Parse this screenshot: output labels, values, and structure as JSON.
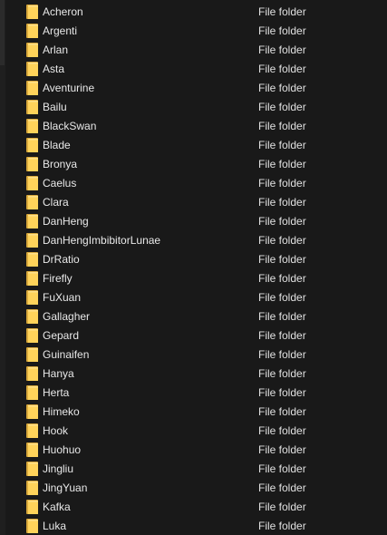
{
  "folder_icon": "folder-icon",
  "colors": {
    "background": "#191919",
    "folder_yellow": "#ffd35a",
    "text": "#e8e8e8"
  },
  "items": [
    {
      "name": "Acheron",
      "type": "File folder"
    },
    {
      "name": "Argenti",
      "type": "File folder"
    },
    {
      "name": "Arlan",
      "type": "File folder"
    },
    {
      "name": "Asta",
      "type": "File folder"
    },
    {
      "name": "Aventurine",
      "type": "File folder"
    },
    {
      "name": "Bailu",
      "type": "File folder"
    },
    {
      "name": "BlackSwan",
      "type": "File folder"
    },
    {
      "name": "Blade",
      "type": "File folder"
    },
    {
      "name": "Bronya",
      "type": "File folder"
    },
    {
      "name": "Caelus",
      "type": "File folder"
    },
    {
      "name": "Clara",
      "type": "File folder"
    },
    {
      "name": "DanHeng",
      "type": "File folder"
    },
    {
      "name": "DanHengImbibitorLunae",
      "type": "File folder"
    },
    {
      "name": "DrRatio",
      "type": "File folder"
    },
    {
      "name": "Firefly",
      "type": "File folder"
    },
    {
      "name": "FuXuan",
      "type": "File folder"
    },
    {
      "name": "Gallagher",
      "type": "File folder"
    },
    {
      "name": "Gepard",
      "type": "File folder"
    },
    {
      "name": "Guinaifen",
      "type": "File folder"
    },
    {
      "name": "Hanya",
      "type": "File folder"
    },
    {
      "name": "Herta",
      "type": "File folder"
    },
    {
      "name": "Himeko",
      "type": "File folder"
    },
    {
      "name": "Hook",
      "type": "File folder"
    },
    {
      "name": "Huohuo",
      "type": "File folder"
    },
    {
      "name": "Jingliu",
      "type": "File folder"
    },
    {
      "name": "JingYuan",
      "type": "File folder"
    },
    {
      "name": "Kafka",
      "type": "File folder"
    },
    {
      "name": "Luka",
      "type": "File folder"
    }
  ]
}
